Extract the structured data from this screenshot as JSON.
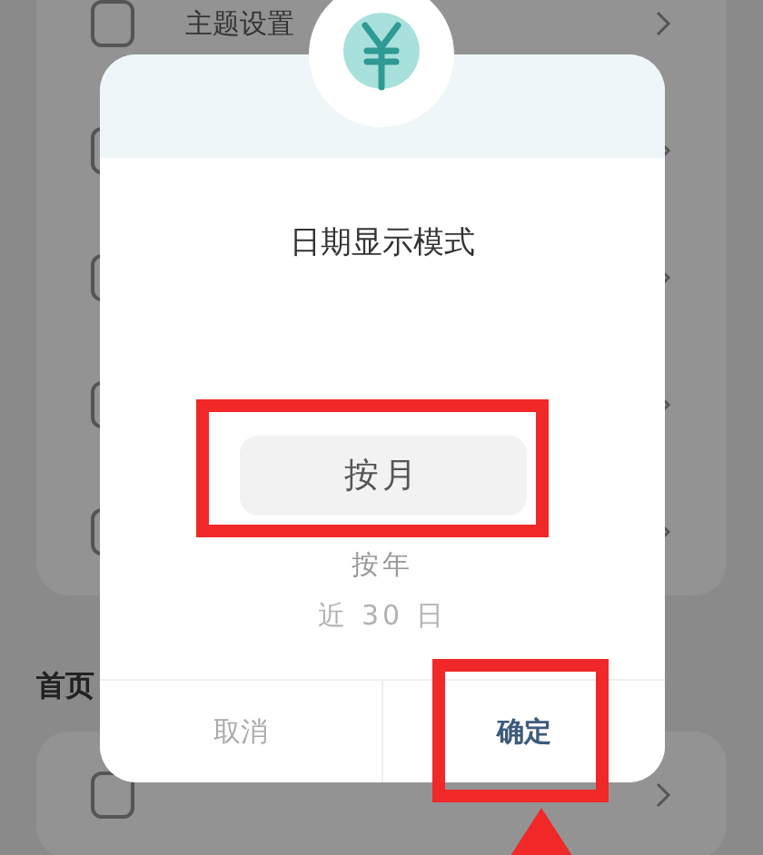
{
  "settings": {
    "rows": [
      {
        "label": "主题设置"
      },
      {
        "label": ""
      },
      {
        "label": ""
      },
      {
        "label": ""
      },
      {
        "label": ""
      }
    ]
  },
  "section": {
    "title": "首页",
    "rows": [
      {
        "label": ""
      }
    ]
  },
  "dialog": {
    "title": "日期显示模式",
    "options": [
      {
        "label": "按月",
        "selected": true
      },
      {
        "label": "按年",
        "selected": false
      },
      {
        "label": "近 30 日",
        "selected": false
      }
    ],
    "buttons": [
      {
        "label": "取消",
        "kind": "cancel"
      },
      {
        "label": "确定",
        "kind": "confirm"
      }
    ]
  }
}
